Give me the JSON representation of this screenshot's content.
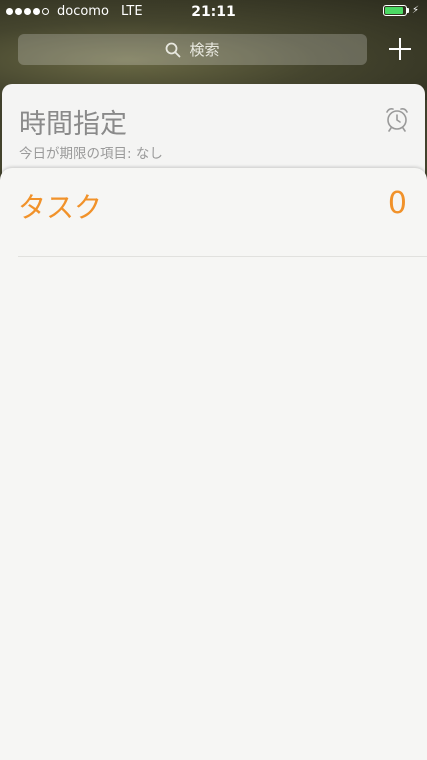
{
  "status_bar": {
    "carrier": "docomo",
    "network": "LTE",
    "time": "21:11",
    "signal_bars_filled": 4,
    "signal_bars_total": 5,
    "battery_level": 0.9
  },
  "search": {
    "placeholder": "検索",
    "icon": "search-icon"
  },
  "header": {
    "add_icon": "plus-icon"
  },
  "scheduled": {
    "title": "時間指定",
    "subtitle": "今日が期限の項目: なし",
    "icon": "alarm-clock-icon"
  },
  "task_list": {
    "title": "タスク",
    "count": "0",
    "accent_color": "#f1922a"
  }
}
